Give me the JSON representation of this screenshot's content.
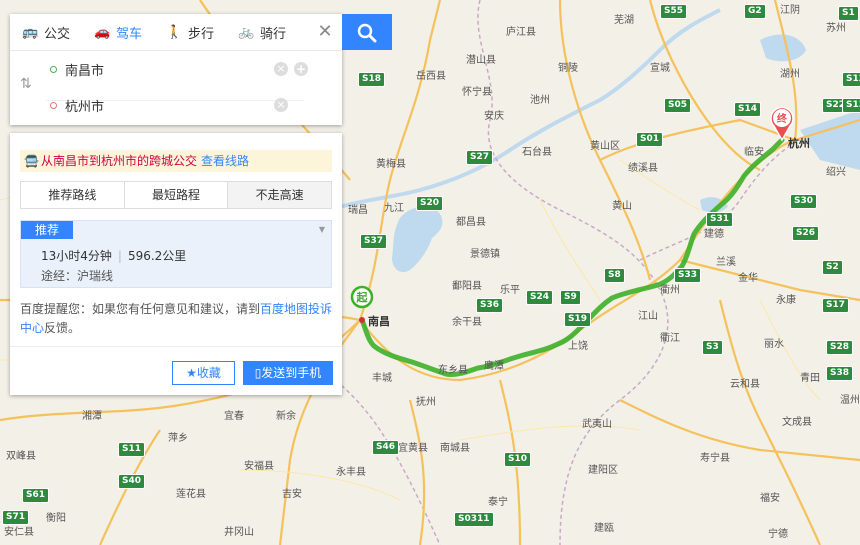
{
  "map": {
    "start_marker": "起",
    "end_marker": "终",
    "route_color": "#3cb029",
    "cities": [
      {
        "name": "南昌",
        "kind": "major"
      },
      {
        "name": "杭州",
        "kind": "major"
      },
      {
        "name": "上饶",
        "kind": "city"
      },
      {
        "name": "衢州",
        "kind": "city"
      },
      {
        "name": "鹰潭",
        "kind": "city"
      },
      {
        "name": "抚州",
        "kind": "city"
      },
      {
        "name": "九江",
        "kind": "city"
      },
      {
        "name": "景德镇",
        "kind": "city"
      },
      {
        "name": "黄山",
        "kind": "city"
      },
      {
        "name": "金华",
        "kind": "city"
      },
      {
        "name": "丽水",
        "kind": "city"
      },
      {
        "name": "芜湖",
        "kind": "city"
      },
      {
        "name": "宣城",
        "kind": "city"
      },
      {
        "name": "湖州",
        "kind": "city"
      },
      {
        "name": "苏州",
        "kind": "city"
      },
      {
        "name": "绍兴",
        "kind": "city"
      },
      {
        "name": "安庆",
        "kind": "city"
      },
      {
        "name": "池州",
        "kind": "city"
      },
      {
        "name": "铜陵",
        "kind": "city"
      },
      {
        "name": "宜春",
        "kind": "city"
      },
      {
        "name": "新余",
        "kind": "city"
      },
      {
        "name": "萍乡",
        "kind": "city"
      },
      {
        "name": "吉安",
        "kind": "city"
      },
      {
        "name": "衡阳",
        "kind": "city"
      },
      {
        "name": "湘潭",
        "kind": "city"
      },
      {
        "name": "温州",
        "kind": "city"
      },
      {
        "name": "建德",
        "kind": "town"
      },
      {
        "name": "兰溪",
        "kind": "town"
      },
      {
        "name": "江山",
        "kind": "town"
      },
      {
        "name": "东乡县",
        "kind": "town"
      },
      {
        "name": "余干县",
        "kind": "town"
      },
      {
        "name": "乐平",
        "kind": "town"
      },
      {
        "name": "临安",
        "kind": "town"
      },
      {
        "name": "瑞昌",
        "kind": "town"
      },
      {
        "name": "都昌县",
        "kind": "town"
      },
      {
        "name": "鄱阳县",
        "kind": "town"
      },
      {
        "name": "丰城",
        "kind": "town"
      },
      {
        "name": "永康",
        "kind": "town"
      },
      {
        "name": "云和县",
        "kind": "town"
      },
      {
        "name": "文成县",
        "kind": "town"
      },
      {
        "name": "建阳区",
        "kind": "town"
      },
      {
        "name": "武夷山",
        "kind": "town"
      },
      {
        "name": "福安",
        "kind": "town"
      },
      {
        "name": "宜黄县",
        "kind": "town"
      },
      {
        "name": "南城县",
        "kind": "town"
      },
      {
        "name": "黄梅县",
        "kind": "town"
      },
      {
        "name": "石台县",
        "kind": "town"
      },
      {
        "name": "庐江县",
        "kind": "town"
      },
      {
        "name": "绩溪县",
        "kind": "town"
      },
      {
        "name": "岳西县",
        "kind": "town"
      },
      {
        "name": "怀宁县",
        "kind": "town"
      },
      {
        "name": "潜山县",
        "kind": "town"
      },
      {
        "name": "黄山区",
        "kind": "town"
      },
      {
        "name": "永丰县",
        "kind": "town"
      },
      {
        "name": "安福县",
        "kind": "town"
      },
      {
        "name": "莲花县",
        "kind": "town"
      },
      {
        "name": "双峰县",
        "kind": "town"
      },
      {
        "name": "安仁县",
        "kind": "town"
      },
      {
        "name": "井冈山",
        "kind": "town"
      },
      {
        "name": "寿宁县",
        "kind": "town"
      },
      {
        "name": "宁德",
        "kind": "town"
      },
      {
        "name": "建瓯",
        "kind": "town"
      },
      {
        "name": "泰宁",
        "kind": "town"
      },
      {
        "name": "衢江",
        "kind": "town"
      },
      {
        "name": "青田",
        "kind": "town"
      },
      {
        "name": "江阴",
        "kind": "town"
      }
    ],
    "shields": [
      "S55",
      "G2",
      "S18",
      "S22",
      "S05",
      "S14",
      "S12",
      "S13",
      "S1",
      "S01",
      "S27",
      "S20",
      "S37",
      "S31",
      "S26",
      "S33",
      "S36",
      "S19",
      "S17",
      "S11",
      "S61",
      "S71",
      "S46",
      "S10",
      "S0311",
      "S28",
      "S38",
      "S2",
      "S3",
      "S9",
      "S8",
      "S24",
      "S30",
      "S40"
    ]
  },
  "search": {
    "modes": [
      {
        "label": "公交",
        "icon": "bus-icon",
        "active": false
      },
      {
        "label": "驾车",
        "icon": "car-icon",
        "active": true
      },
      {
        "label": "步行",
        "icon": "walk-icon",
        "active": false
      },
      {
        "label": "骑行",
        "icon": "bike-icon",
        "active": false
      }
    ],
    "from": "南昌市",
    "to": "杭州市",
    "from_color": "#4caf50",
    "to_color": "#e57373",
    "accent": "#3385ff"
  },
  "result": {
    "banner_text": "从南昌市到杭州市的跨城公交",
    "banner_link": "查看线路",
    "tabs": [
      "推荐路线",
      "最短路程",
      "不走高速"
    ],
    "selected_tab": 2,
    "plan_tag": "推荐",
    "duration": "13小时4分钟",
    "distance": "596.2公里",
    "via": "途经：沪瑞线",
    "tip_prefix": "百度提醒您：如果您有任何意见和建议，请到",
    "tip_link": "百度地图投诉中心",
    "tip_suffix": "反馈。",
    "fav_label": "收藏",
    "send_label": "发送到手机"
  }
}
